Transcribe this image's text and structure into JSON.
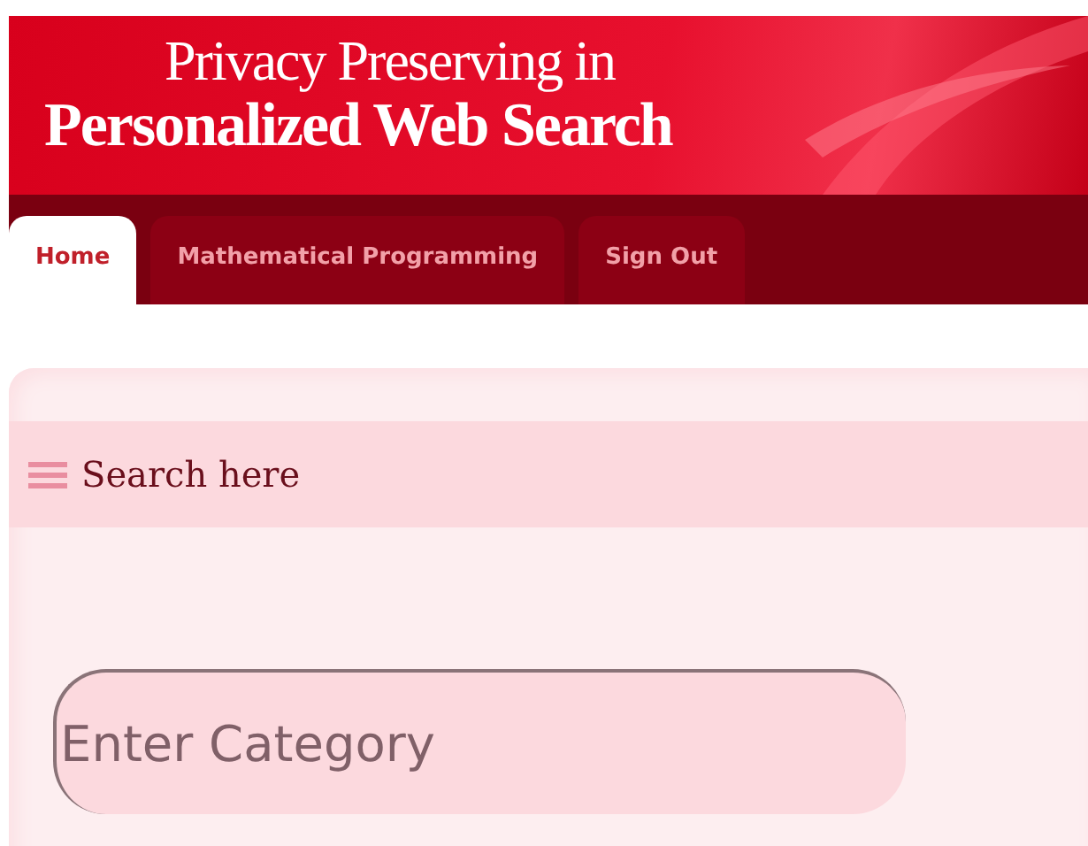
{
  "header": {
    "title_line_1": "Privacy Preserving in",
    "title_line_2": "Personalized Web Search"
  },
  "tabs": [
    {
      "label": "Home",
      "selected": true
    },
    {
      "label": "Mathematical Programming",
      "selected": false
    },
    {
      "label": "Sign Out",
      "selected": false
    }
  ],
  "panel": {
    "title": "Search here",
    "field": {
      "placeholder": "Enter Category"
    }
  }
}
